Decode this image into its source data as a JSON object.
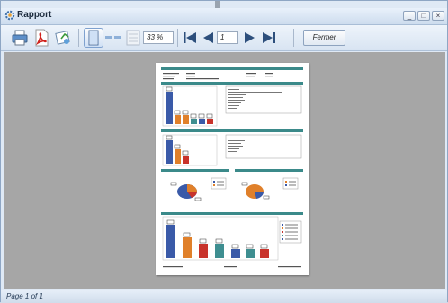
{
  "window": {
    "title": "Rapport",
    "controls": {
      "minimize": "_",
      "maximize": "□",
      "close": "×"
    }
  },
  "toolbar": {
    "icons": [
      "printer-icon",
      "pdf-icon",
      "export-icon",
      "single-page-icon",
      "two-page-icon",
      "multi-page-icon",
      "first-page-icon",
      "previous-page-icon",
      "next-page-icon",
      "last-page-icon"
    ],
    "zoom_value": "33 %",
    "page_value": "1",
    "close_label": "Fermer"
  },
  "status": {
    "text": "Page 1 of 1"
  },
  "colors": {
    "accent_teal": "#3b8a8a",
    "bar_blue": "#3a5aa8",
    "bar_orange": "#e0802a",
    "bar_red": "#c8332b",
    "bar_teal": "#3e8e90",
    "viewer_bg": "#a6a6a6"
  }
}
